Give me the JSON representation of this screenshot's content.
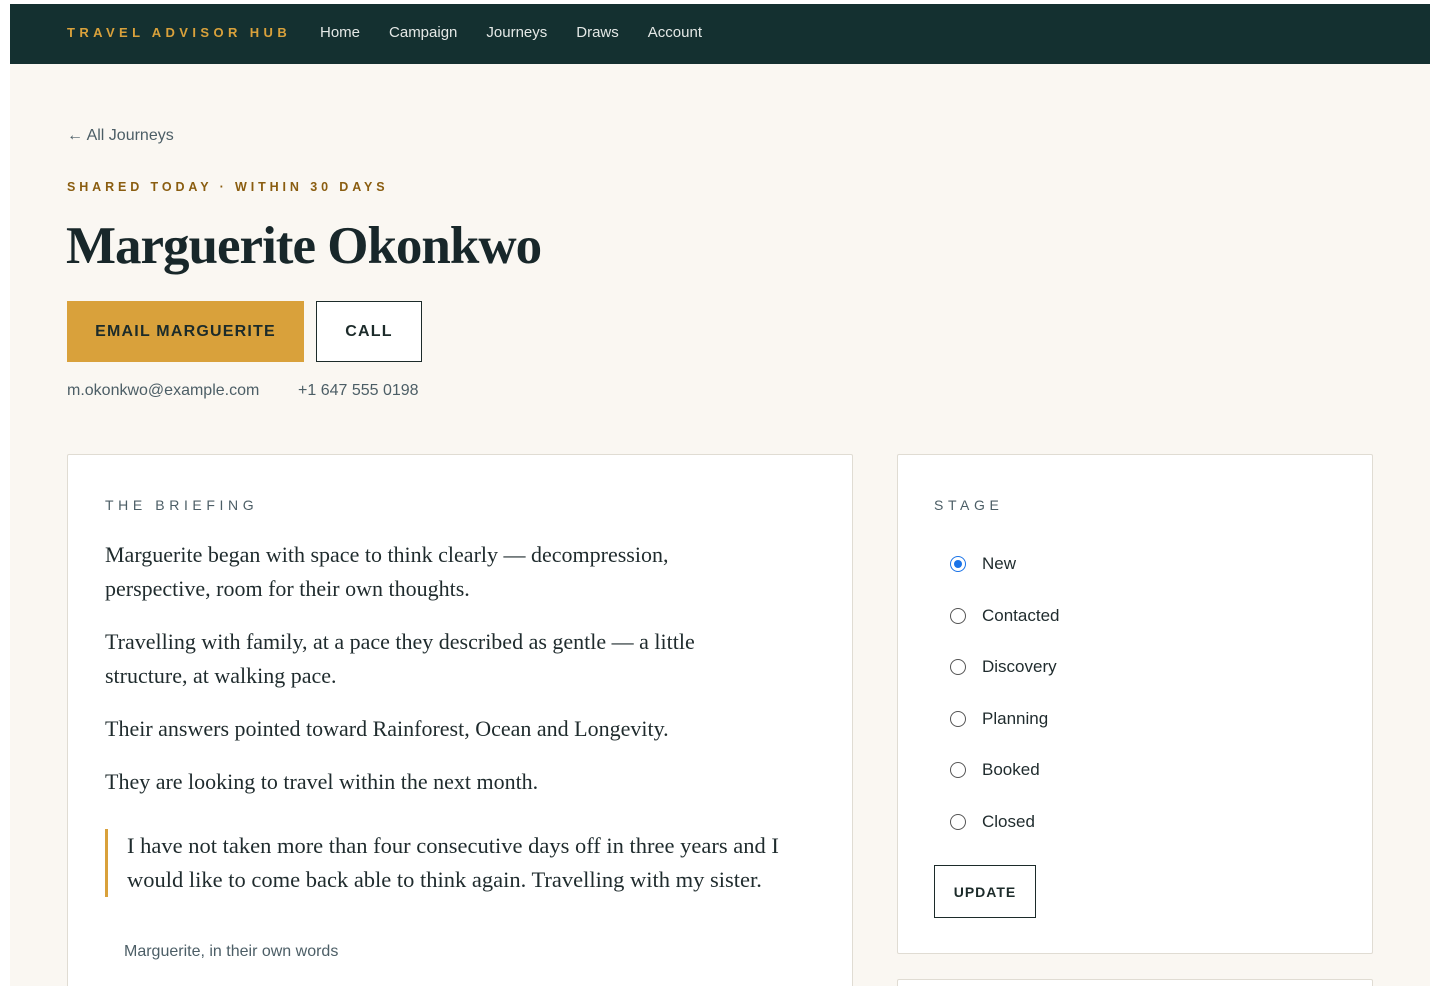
{
  "nav": {
    "brand": "TRAVEL ADVISOR HUB",
    "links": [
      "Home",
      "Campaign",
      "Journeys",
      "Draws",
      "Account"
    ]
  },
  "breadcrumb": {
    "back_label": "← All Journeys"
  },
  "header": {
    "eyebrow": "SHARED TODAY · WITHIN 30 DAYS",
    "name": "Marguerite Okonkwo",
    "email_button": "EMAIL MARGUERITE",
    "call_button": "CALL",
    "email": "m.okonkwo@example.com",
    "phone": "+1 647 555 0198"
  },
  "briefing": {
    "label": "THE BRIEFING",
    "paragraphs": [
      "Marguerite began with space to think clearly — decompression, perspective, room for their own thoughts.",
      "Travelling with family, at a pace they described as gentle — a little structure, at walking pace.",
      "Their answers pointed toward Rainforest, Ocean and Longevity.",
      "They are looking to travel within the next month."
    ],
    "quote": "I have not taken more than four consecutive days off in three years and I would like to come back able to think again. Travelling with my sister.",
    "quote_attribution": "Marguerite, in their own words"
  },
  "stage": {
    "label": "STAGE",
    "options": [
      "New",
      "Contacted",
      "Discovery",
      "Planning",
      "Booked",
      "Closed"
    ],
    "selected": "New",
    "update_button": "UPDATE"
  },
  "colors": {
    "nav_bg": "#143030",
    "accent": "#d9a13b",
    "page_bg": "#faf7f2"
  }
}
